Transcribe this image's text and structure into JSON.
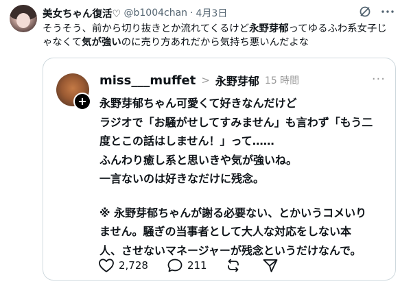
{
  "tweet": {
    "name": "美女ちゃん復活♡",
    "handle": "@b1004chan",
    "separator": "·",
    "date": "4月3日",
    "text_parts": [
      {
        "text": "そうそう、前から切り抜きとか流れてくるけど",
        "bold": false
      },
      {
        "text": "永野芽郁",
        "bold": true
      },
      {
        "text": "ってゆるふわ系女子じゃなくて",
        "bold": false
      },
      {
        "text": "気が強い",
        "bold": true
      },
      {
        "text": "のに売り方あれだから気持ち悪いんだよな",
        "bold": false
      }
    ]
  },
  "quoted": {
    "username": "miss___muffet",
    "chevron": ">",
    "topic": "永野芽郁",
    "time": "15 時間",
    "more": "···",
    "follow_plus": "+",
    "paragraph1": [
      "永野芽郁ちゃん可愛くて好きなんだけど",
      "ラジオで「お騒がせしてすみません」も言わず「もう二",
      "度とこの話はしません！」って……",
      "ふんわり癒し系と思いきや気が強いね。",
      "一言ないのは好きなだけに残念。"
    ],
    "paragraph2": [
      "※ 永野芽郁ちゃんが謝る必要ない、とかいうコメいり",
      "ません。騒ぎの当事者として大人な対応をしない本",
      "人、させないマネージャーが残念というだけなんで。"
    ],
    "likes": "2,728",
    "replies": "211"
  },
  "icons": {
    "top": [
      "grok-icon",
      "more-icon"
    ],
    "actions": [
      "heart-icon",
      "reply-icon",
      "repost-icon",
      "share-icon"
    ]
  }
}
